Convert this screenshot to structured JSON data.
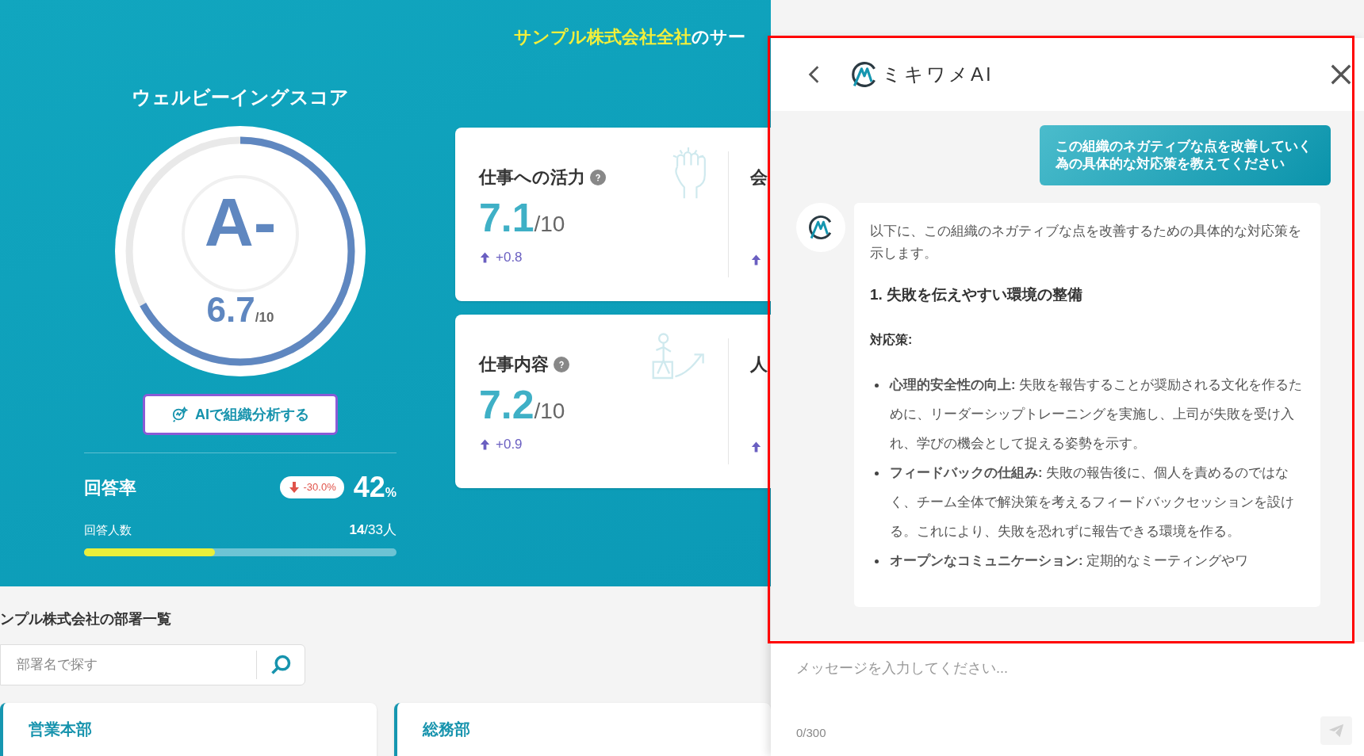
{
  "header": {
    "title_highlight": "サンプル株式会社全社",
    "title_rest": "のサー"
  },
  "score": {
    "title": "ウェルビーイングスコア",
    "grade": "A-",
    "value": "6.7",
    "max": "/10",
    "level": 0.67
  },
  "ai_button": {
    "label": "AIで組織分析する"
  },
  "response_rate": {
    "label": "回答率",
    "change": "-30.0%",
    "value": "42",
    "unit": "%",
    "count_label": "回答人数",
    "count": "14",
    "total": "/33人",
    "level": 0.42,
    "rising": false
  },
  "metric_cards": [
    {
      "kind": "energy",
      "title": "仕事への活力",
      "value": "7.1",
      "max": "/10",
      "change": "+0.8",
      "rising": true,
      "next_title": "会"
    },
    {
      "kind": "work",
      "title": "仕事内容",
      "value": "7.2",
      "max": "/10",
      "change": "+0.9",
      "rising": true,
      "next_title": "人"
    }
  ],
  "departments": {
    "title": "ンプル株式会社の部署一覧",
    "search_placeholder": "部署名で探す",
    "items": [
      "営業本部",
      "総務部"
    ]
  },
  "chat": {
    "title": "ミキワメAI",
    "user_message": "この組織のネガティブな点を改善していく為の具体的な対応策を教えてください",
    "blocks": [
      {
        "kind": "paragraph",
        "text": "以下に、この組織のネガティブな点を改善するための具体的な対応策を示します。"
      },
      {
        "kind": "heading",
        "text": "1. 失敗を伝えやすい環境の整備"
      },
      {
        "kind": "label",
        "text": "対応策:"
      },
      {
        "kind": "bullets",
        "items": [
          "**心理的安全性の向上:** 失敗を報告することが奨励される文化を作るために、リーダーシップトレーニングを実施し、上司が失敗を受け入れ、学びの機会として捉える姿勢を示す。",
          "**フィードバックの仕組み:** 失敗の報告後に、個人を責めるのではなく、チーム全体で解決策を考えるフィードバックセッションを設ける。これにより、失敗を恐れずに報告できる環境を作る。",
          "**オープンなコミュニケーション:** 定期的なミーティングやワ"
        ]
      }
    ],
    "input_placeholder": "メッセージを入力してください...",
    "counter": "0/300"
  }
}
